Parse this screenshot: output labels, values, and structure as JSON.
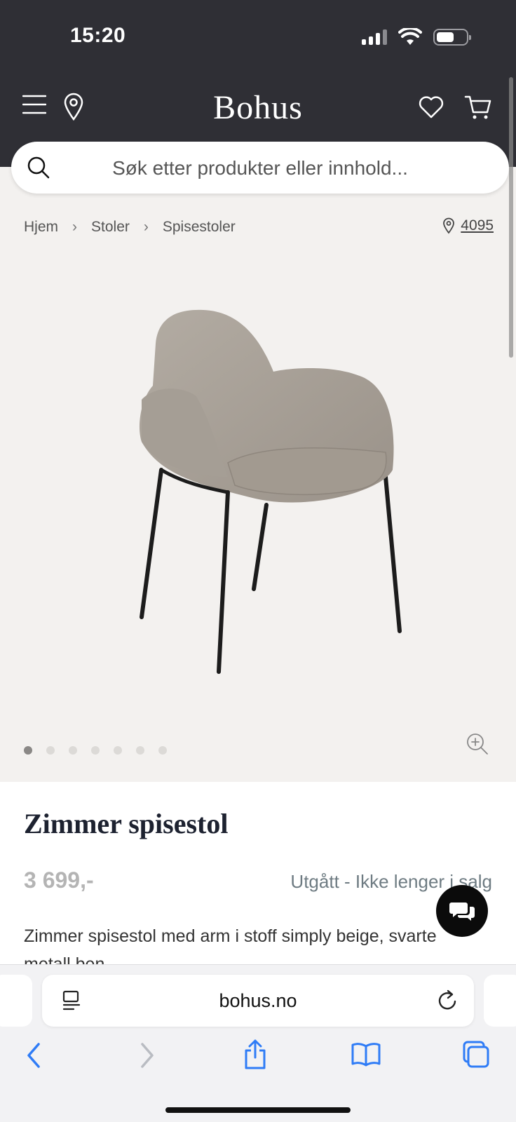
{
  "status": {
    "time": "15:20"
  },
  "header": {
    "logo": "Bohus"
  },
  "search": {
    "placeholder": "Søk etter produkter eller innhold..."
  },
  "breadcrumb": [
    "Hjem",
    "Stoler",
    "Spisestoler"
  ],
  "store": {
    "code": "4095"
  },
  "gallery": {
    "image_count": 7,
    "active_index": 0
  },
  "product": {
    "title": "Zimmer spisestol",
    "price": "3 699,-",
    "availability": "Utgått - Ikke lenger i salg",
    "description": "Zimmer spisestol med arm i stoff simply beige, svarte metall ben"
  },
  "browser": {
    "url": "bohus.no"
  },
  "colors": {
    "header_bg": "#2f2f35",
    "page_bg": "#f3f1ef",
    "ios_blue": "#2f7cf6"
  },
  "icons": [
    "menu-icon",
    "location-pin-icon",
    "heart-icon",
    "cart-icon",
    "search-icon",
    "zoom-in-icon",
    "chat-icon",
    "reader-icon",
    "reload-icon",
    "back-icon",
    "forward-icon",
    "share-icon",
    "bookmarks-icon",
    "tabs-icon"
  ]
}
